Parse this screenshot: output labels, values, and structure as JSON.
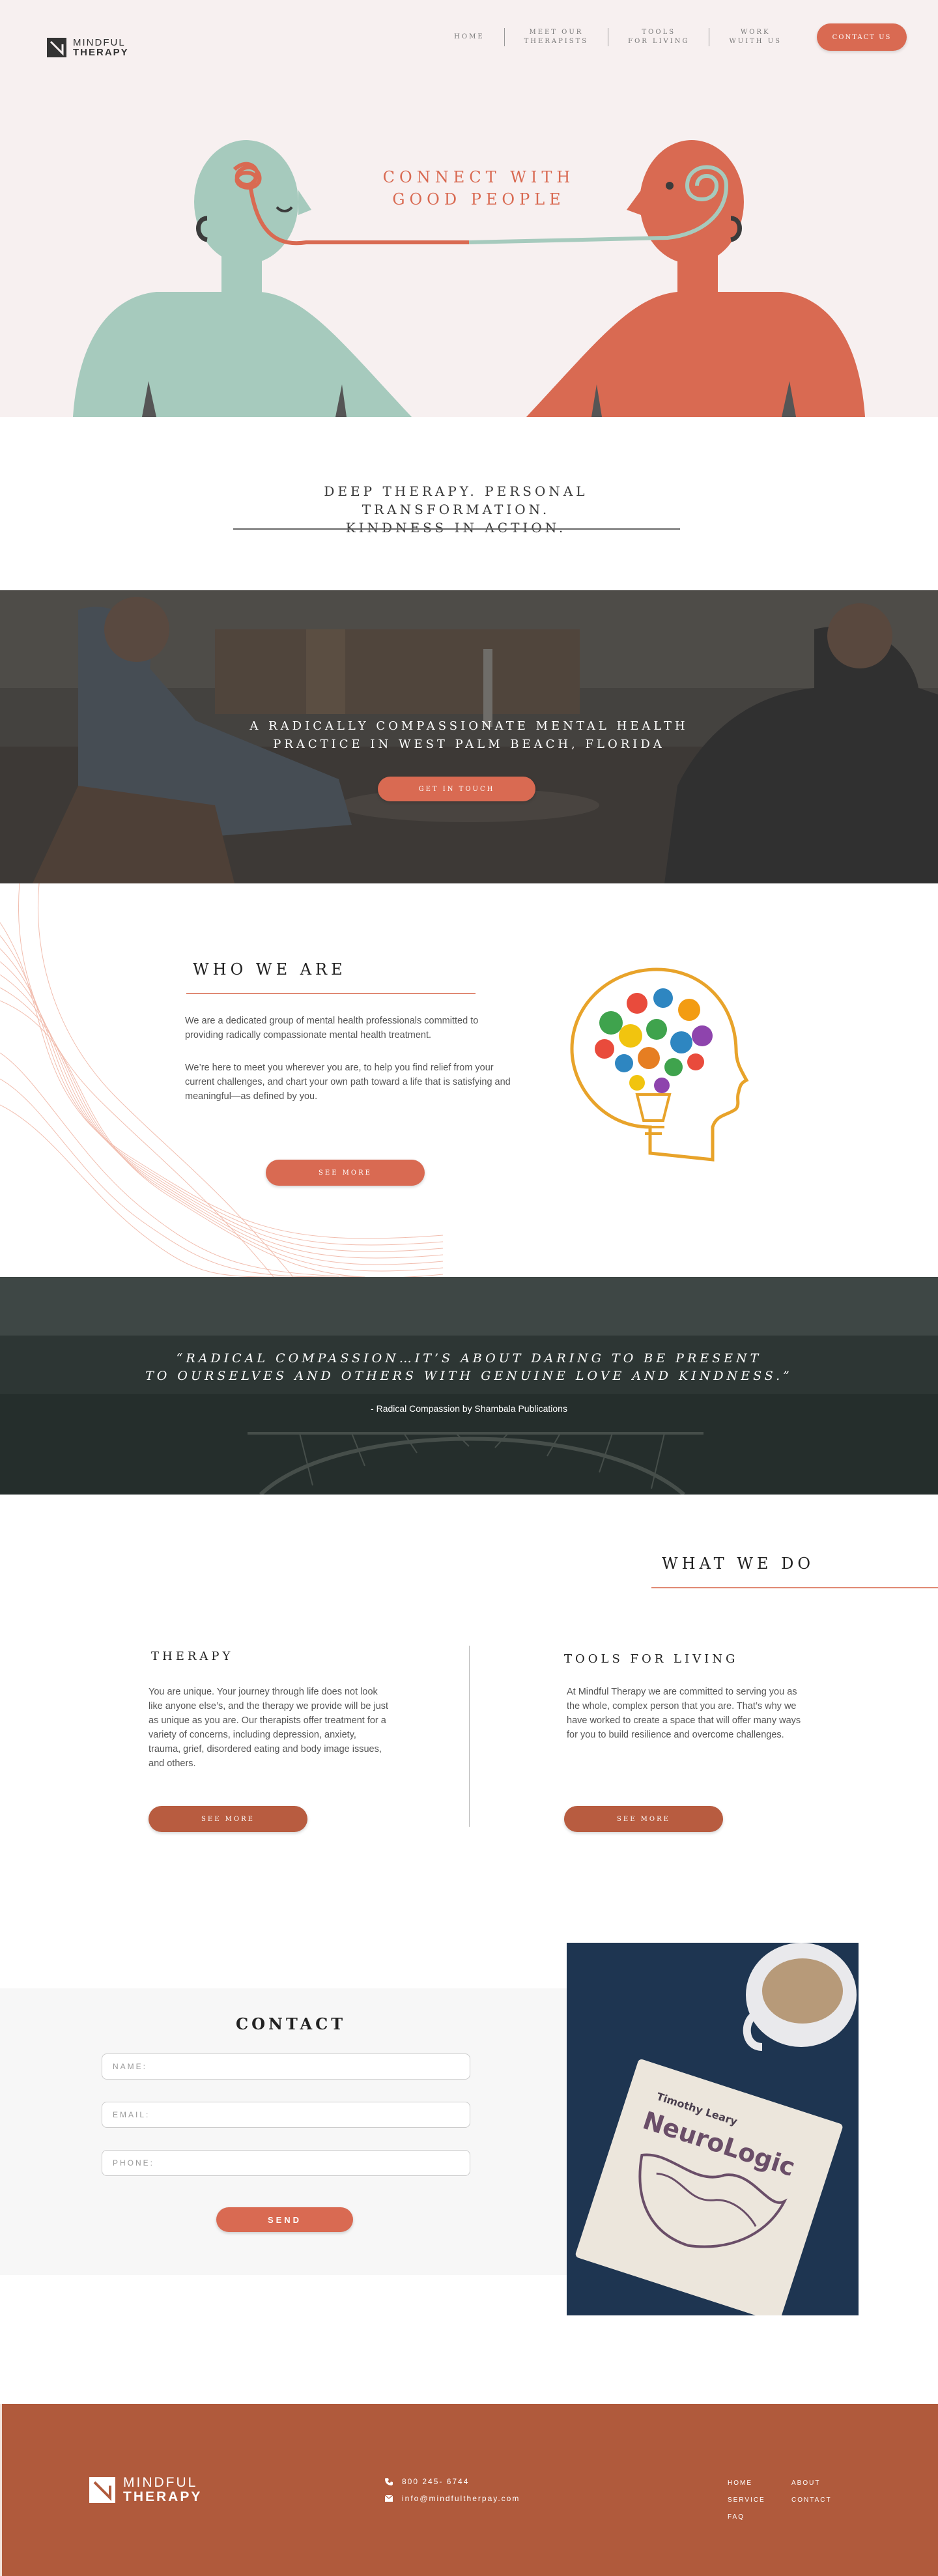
{
  "brand": {
    "logo_line1": "MINDFUL",
    "logo_line2": "THERAPY"
  },
  "nav": {
    "items": [
      {
        "label": "HOME"
      },
      {
        "label_line1": "MEET OUR",
        "label_line2": "THERAPISTS"
      },
      {
        "label_line1": "TOOLS",
        "label_line2": "FOR LIVING"
      },
      {
        "label_line1": "WORK",
        "label_line2": "WUITH US"
      }
    ],
    "cta": "CONTACT US"
  },
  "hero": {
    "title_line1": "CONNECT WITH",
    "title_line2": "GOOD PEOPLE"
  },
  "tagline": {
    "line1": "DEEP THERAPY. PERSONAL TRANSFORMATION.",
    "line2": "KINDNESS IN ACTION."
  },
  "band1": {
    "line1": "A RADICALLY COMPASSIONATE MENTAL HEALTH",
    "line2": "PRACTICE IN WEST PALM BEACH, FLORIDA",
    "button": "GET IN TOUCH"
  },
  "who": {
    "title": "WHO WE ARE",
    "p1": "We are a dedicated group of mental health professionals committed to providing radically compassionate mental health treatment.",
    "p2": "We’re here to meet you wherever you are, to help you find relief from your current challenges, and chart your own path toward a life that is satisfying and meaningful—as defined by you.",
    "button": "SEE MORE"
  },
  "quote": {
    "line1": "“RADICAL COMPASSION…IT’S ABOUT DARING TO BE PRESENT",
    "line2": "TO OURSELVES AND OTHERS WITH GENUINE LOVE AND KINDNESS.”",
    "attribution": "- Radical Compassion by Shambala Publications"
  },
  "wwd": {
    "title": "WHAT WE DO",
    "therapy": {
      "title": "THERAPY",
      "text": "You are unique. Your journey through life does not look like anyone else’s, and the therapy we provide will be just as unique as you are. Our therapists offer treatment for a variety of concerns, including depression, anxiety, trauma, grief, disordered eating and body image issues, and others.",
      "button": "SEE MORE"
    },
    "tools": {
      "title": "TOOLS FOR LIVING",
      "text": "At Mindful Therapy we are committed to serving you as the whole, complex person that you are. That’s why we have worked to create a space that will offer many ways for you to build resilience and overcome challenges.",
      "button": "SEE MORE"
    }
  },
  "contact": {
    "title": "CONTACT",
    "name_placeholder": "NAME:",
    "email_placeholder": "EMAIL:",
    "phone_placeholder": "PHONE:",
    "button": "SEND"
  },
  "book": {
    "author": "Timothy Leary",
    "title": "NeuroLogic"
  },
  "footer": {
    "phone": "800 245- 6744",
    "email": "info@mindfultherpay.com",
    "links": {
      "home": "HOME",
      "about": "ABOUT",
      "service": "SERVICE",
      "contact": "CONTACT",
      "faq": "FAQ"
    }
  },
  "colors": {
    "accent": "#d96a52",
    "accent_dark": "#b05a3c",
    "mint": "#a6cabd",
    "hero_bg": "#f7f0f0"
  }
}
